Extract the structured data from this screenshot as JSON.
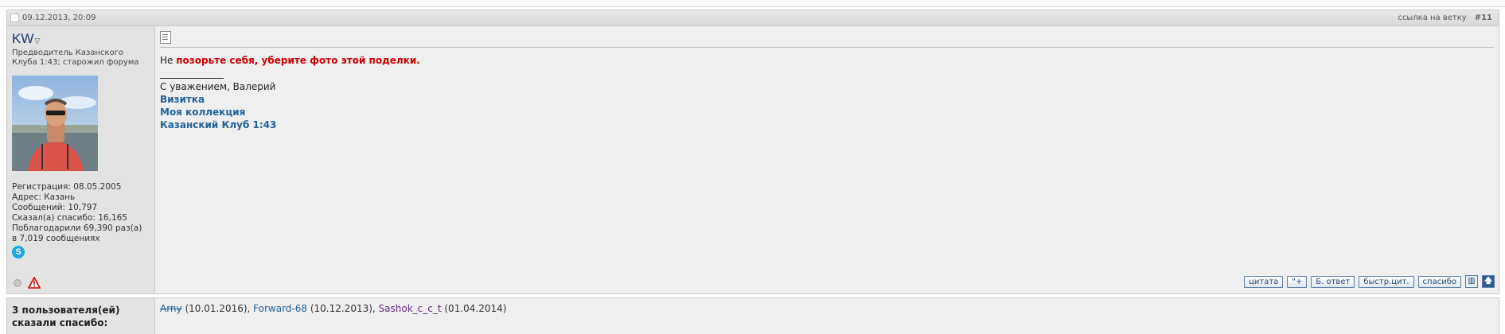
{
  "post": {
    "date": "09.12.2013, 20:09",
    "thread_link": "ссылка на ветку",
    "post_number": "#11"
  },
  "user": {
    "name": "KW",
    "title": "Предводитель Казанского Клуба 1:43; старожил форума",
    "registration": "Регистрация: 08.05.2005",
    "address": "Адрес: Казань",
    "messages": "Сообщений: 10,797",
    "said_thanks": "Сказал(а) спасибо: 16,165",
    "was_thanked_1": "Поблагодарили 69,390 раз(а)",
    "was_thanked_2": "в 7,019 сообщениях",
    "skype_letter": "S"
  },
  "message": {
    "prefix": "Не ",
    "highlight": "позорьте себя, уберите фото этой поделки.",
    "highlight_color": "#cc0000"
  },
  "signature": {
    "greeting": "С уважением, Валерий",
    "links": [
      "Визитка",
      "Моя коллекция",
      "Казанский Клуб 1:43"
    ]
  },
  "buttons": {
    "quote": "цитата",
    "multiquote": "\"+",
    "quick_reply": "Б. ответ",
    "quick_quote": "быстр.цит.",
    "thanks": "спасибо"
  },
  "thanks_block": {
    "label": "3 пользователя(ей) сказали спасибо:",
    "entries": [
      {
        "user": "Arny",
        "date": " (10.01.2016), "
      },
      {
        "user": "Forward-68",
        "date": " (10.12.2013), "
      },
      {
        "user": "Sashok_c_c_t",
        "date": " (01.04.2014)"
      }
    ]
  }
}
